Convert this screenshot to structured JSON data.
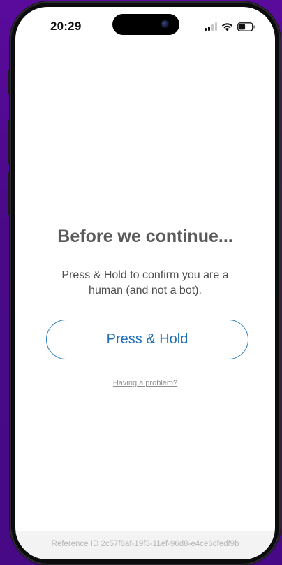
{
  "status_bar": {
    "time": "20:29",
    "icons": [
      "signal-icon",
      "wifi-icon",
      "battery-icon"
    ]
  },
  "challenge": {
    "title": "Before we continue...",
    "message": "Press & Hold to confirm you are a human (and not a bot).",
    "button_label": "Press & Hold",
    "problem_link": "Having a problem?"
  },
  "footer": {
    "reference": "Reference ID 2c57f6af-19f3-11ef-96d8-e4ce6cfedf9b"
  },
  "colors": {
    "background": "#4a0a88",
    "button_accent": "#1f6fb2",
    "title_text": "#5a5a5a"
  }
}
